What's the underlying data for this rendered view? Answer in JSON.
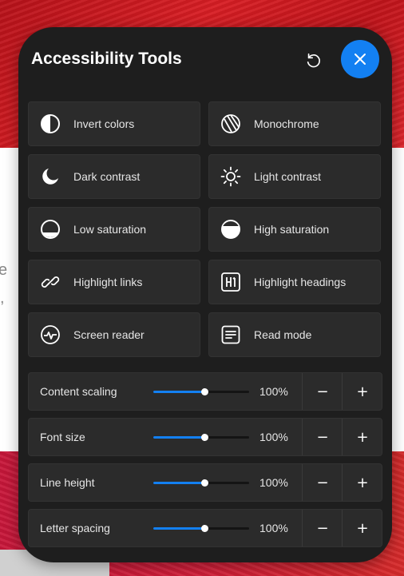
{
  "panel": {
    "title": "Accessibility Tools",
    "close_icon": "close-icon",
    "reset_icon": "reset-icon",
    "accent": "#1380f2",
    "background": "#1e1e1e"
  },
  "background_page": {
    "fragment_1": "e",
    "fragment_2": ","
  },
  "tools": [
    {
      "label": "Invert colors",
      "icon": "invert-colors-icon"
    },
    {
      "label": "Monochrome",
      "icon": "monochrome-icon"
    },
    {
      "label": "Dark contrast",
      "icon": "moon-icon"
    },
    {
      "label": "Light contrast",
      "icon": "sun-icon"
    },
    {
      "label": "Low saturation",
      "icon": "low-saturation-icon"
    },
    {
      "label": "High saturation",
      "icon": "high-saturation-icon"
    },
    {
      "label": "Highlight links",
      "icon": "link-icon"
    },
    {
      "label": "Highlight headings",
      "icon": "heading-icon"
    },
    {
      "label": "Screen reader",
      "icon": "screen-reader-icon"
    },
    {
      "label": "Read mode",
      "icon": "read-mode-icon"
    }
  ],
  "adjusters": [
    {
      "label": "Content scaling",
      "value": "100%",
      "level": 0.53,
      "minus": "−",
      "plus": "+"
    },
    {
      "label": "Font size",
      "value": "100%",
      "level": 0.53,
      "minus": "−",
      "plus": "+"
    },
    {
      "label": "Line height",
      "value": "100%",
      "level": 0.53,
      "minus": "−",
      "plus": "+"
    },
    {
      "label": "Letter spacing",
      "value": "100%",
      "level": 0.53,
      "minus": "−",
      "plus": "+"
    }
  ]
}
